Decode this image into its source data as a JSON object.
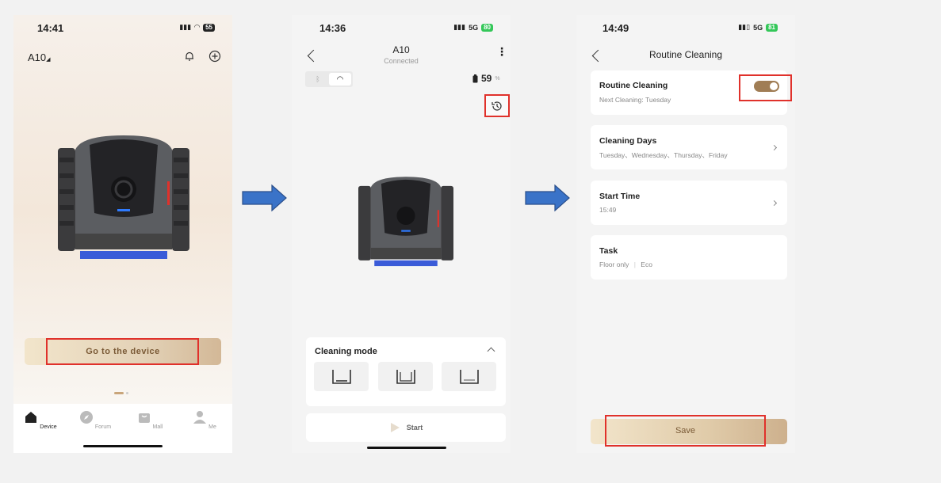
{
  "screen1": {
    "time": "14:41",
    "battery": "55",
    "device_title": "A10",
    "primary_button": "Go to the device",
    "tabs": [
      {
        "label": "Device",
        "icon": "home-icon"
      },
      {
        "label": "Forum",
        "icon": "compass-icon"
      },
      {
        "label": "Mall",
        "icon": "bag-icon"
      },
      {
        "label": "Me",
        "icon": "person-icon"
      }
    ],
    "active_tab": "Device"
  },
  "screen2": {
    "time": "14:36",
    "network": "5G",
    "battery": "80",
    "device_name": "A10",
    "connection_status": "Connected",
    "battery_level": "59",
    "battery_unit": "%",
    "cleaning_mode_title": "Cleaning mode",
    "modes": [
      "floor-mode-icon",
      "floor-wall-mode-icon",
      "waterline-mode-icon"
    ],
    "start_label": "Start"
  },
  "screen3": {
    "time": "14:49",
    "network": "5G",
    "battery": "81",
    "title": "Routine Cleaning",
    "routine": {
      "title": "Routine Cleaning",
      "subtitle": "Next Cleaning: Tuesday",
      "enabled": true
    },
    "days": {
      "title": "Cleaning Days",
      "subtitle": "Tuesday、Wednesday、Thursday、Friday"
    },
    "start_time": {
      "title": "Start Time",
      "subtitle": "15:49"
    },
    "task": {
      "title": "Task",
      "mode": "Floor only",
      "power": "Eco"
    },
    "save_label": "Save"
  },
  "colors": {
    "accent_brown": "#a07d55",
    "highlight_red": "#e0312b",
    "arrow_blue": "#3a73c8"
  }
}
